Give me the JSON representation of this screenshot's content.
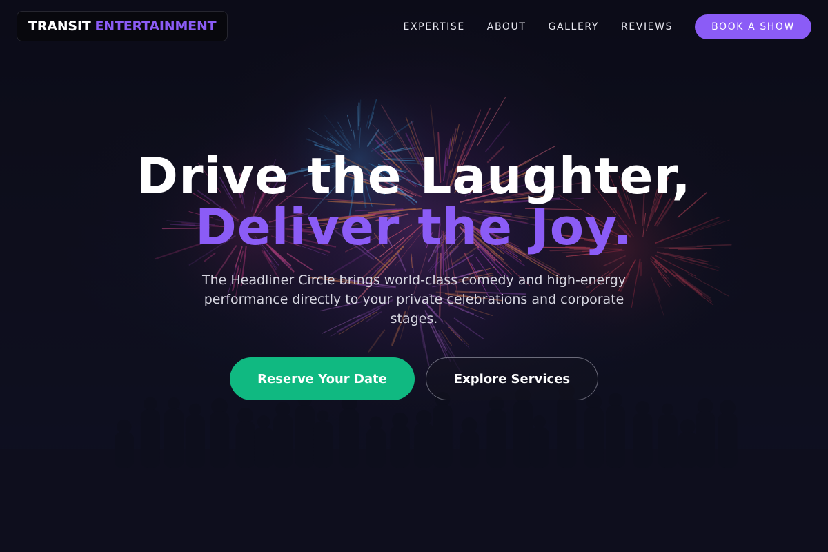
{
  "brand": {
    "part1": "TRANSIT",
    "part2": "ENTERTAINMENT"
  },
  "nav": {
    "links": [
      "EXPERTISE",
      "ABOUT",
      "GALLERY",
      "REVIEWS"
    ],
    "cta": "BOOK A SHOW"
  },
  "hero": {
    "headline_line1": "Drive the Laughter,",
    "headline_line2": "Deliver the Joy.",
    "subtext": "The Headliner Circle brings world-class comedy and high-energy performance directly to your private celebrations and corporate stages.",
    "primary_cta": "Reserve Your Date",
    "secondary_cta": "Explore Services"
  },
  "colors": {
    "accent_purple": "#8b5cf6",
    "accent_green": "#10b981",
    "background": "#111225"
  }
}
